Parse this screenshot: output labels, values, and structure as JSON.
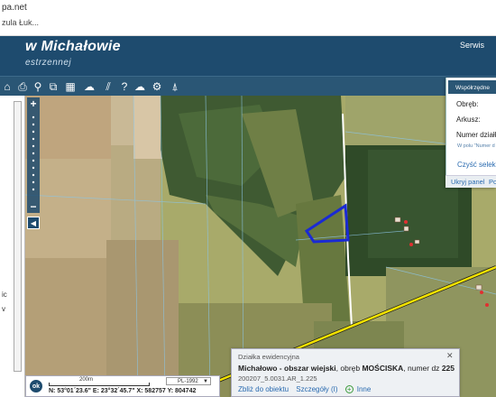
{
  "browser": {
    "url": "pa.net",
    "bookmark": "zula Łuk..."
  },
  "header": {
    "title": "w Michałowie",
    "subtitle": "estrzennej",
    "link": "Serwis"
  },
  "toolbar": {
    "icons": [
      "home-icon",
      "print-icon",
      "pan-icon",
      "layers-icon",
      "map-icon",
      "cloud-icon",
      "measure-icon",
      "help-icon",
      "cloud-download-icon",
      "settings-icon",
      "road-icon"
    ]
  },
  "left_panel": {
    "texts": [
      "ic",
      "v"
    ]
  },
  "right_panel": {
    "tab_label": "Współrzędne",
    "obreb_label": "Obręb:",
    "arkusz_label": "Arkusz:",
    "numer_label": "Numer działk",
    "note": "W polu \"Numer d",
    "clear_link": "Czyść selekc",
    "hide_panel": "Ukryj panel",
    "footer_extra": "Po"
  },
  "parcel": {
    "header": "Działka ewidencyjna",
    "municipality": "Michałowo - obszar wiejski",
    "obreb_prefix": ", obręb ",
    "obreb": "MOŚCISKA",
    "number_prefix": ", numer dz ",
    "number": "225",
    "id": "200207_5.0031.AR_1.225",
    "links": {
      "zoom": "Zbliż do obiektu",
      "details": "Szczegóły (I)",
      "other": "Inne"
    },
    "close": "✕"
  },
  "status": {
    "ok_label": "ok",
    "scale_label": "200m",
    "crs": "PL-1992",
    "coords": "N: 53°01´23.6\"  E: 23°32´45.7\"  X: 582757   Y: 804742"
  },
  "colors": {
    "header": "#1e4b6e",
    "toolbar": "#2a5675",
    "parcel_outline": "#1a2ad4",
    "road": "#f2e200",
    "link": "#2a6bb0"
  }
}
